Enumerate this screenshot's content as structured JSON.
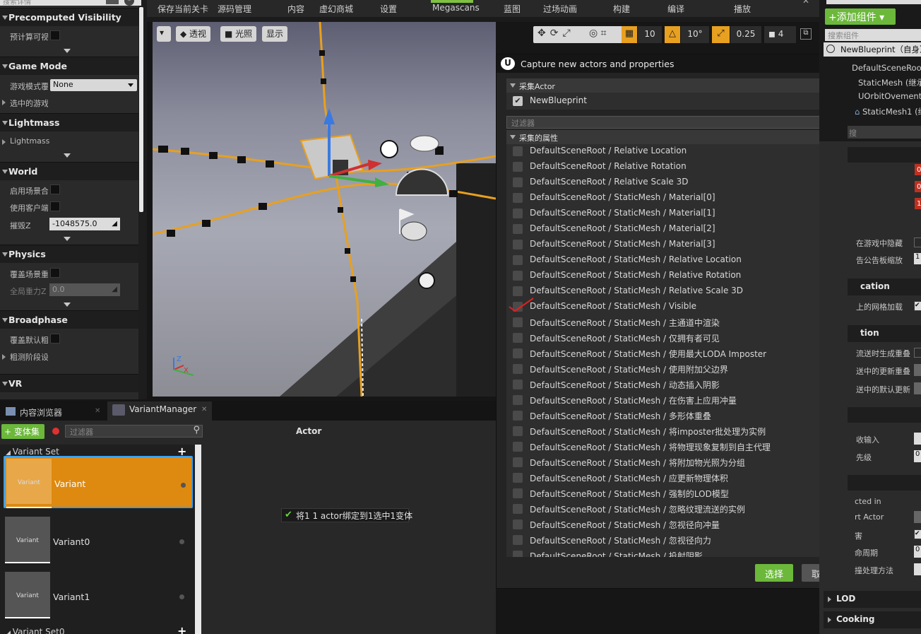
{
  "left_panel": {
    "sections": [
      {
        "title": "Precomputed Visibility"
      },
      {
        "title": "Game Mode"
      },
      {
        "title": "Lightmass"
      },
      {
        "title": "World"
      },
      {
        "title": "Physics"
      },
      {
        "title": "Broadphase"
      },
      {
        "title": "VR"
      }
    ],
    "props": {
      "precompute": "预计算可视",
      "game_mode": "游戏模式覆",
      "game_mode_value": "None",
      "selected_game": "选中的游戏",
      "lightmass": "Lightmass",
      "enable_world": "启用场景合",
      "use_client": "使用客户端",
      "kill_z": "摧毁Z",
      "kill_z_value": "-1048575.0",
      "override_physics": "覆盖场景重",
      "global_gravity": "全局重力Z",
      "global_gravity_value": "0.0",
      "override_broadphase": "覆盖默认粗",
      "broadphase_stage": "粗测阶段设"
    }
  },
  "toolbar": {
    "items": [
      "保存当前关卡",
      "源码管理",
      "内容",
      "虚幻商城",
      "设置",
      "Megascans",
      "蓝图",
      "过场动画",
      "构建",
      "编译",
      "播放"
    ],
    "search_placeholder": "搜索详情"
  },
  "viewport": {
    "perspective": "透视",
    "lit": "光照",
    "show": "显示",
    "grid_snap": "10",
    "rot_snap": "10°",
    "scale_snap": "0.25",
    "cam_speed": "4"
  },
  "dialog": {
    "title": "Capture new actors and properties",
    "actor_section": "采集Actor",
    "actor_name": "NewBlueprint",
    "filter_placeholder": "过滤器",
    "props_section": "采集的属性",
    "properties": [
      "DefaultSceneRoot / Relative Location",
      "DefaultSceneRoot / Relative Rotation",
      "DefaultSceneRoot / Relative Scale 3D",
      "DefaultSceneRoot / StaticMesh / Material[0]",
      "DefaultSceneRoot / StaticMesh / Material[1]",
      "DefaultSceneRoot / StaticMesh / Material[2]",
      "DefaultSceneRoot / StaticMesh / Material[3]",
      "DefaultSceneRoot / StaticMesh / Relative Location",
      "DefaultSceneRoot / StaticMesh / Relative Rotation",
      "DefaultSceneRoot / StaticMesh / Relative Scale 3D",
      "DefaultSceneRoot / StaticMesh / Visible",
      "DefaultSceneRoot / StaticMesh / 主通道中渲染",
      "DefaultSceneRoot / StaticMesh / 仅拥有者可见",
      "DefaultSceneRoot / StaticMesh / 使用最大LODA Imposter",
      "DefaultSceneRoot / StaticMesh / 使用附加父边界",
      "DefaultSceneRoot / StaticMesh / 动态插入阴影",
      "DefaultSceneRoot / StaticMesh / 在伤害上应用冲量",
      "DefaultSceneRoot / StaticMesh / 多形体重叠",
      "DefaultSceneRoot / StaticMesh / 将imposter批处理为实例",
      "DefaultSceneRoot / StaticMesh / 将物理现象复制到自主代理",
      "DefaultSceneRoot / StaticMesh / 将附加物光照为分组",
      "DefaultSceneRoot / StaticMesh / 应更新物理体积",
      "DefaultSceneRoot / StaticMesh / 强制的LOD模型",
      "DefaultSceneRoot / StaticMesh / 忽略纹理流送的实例",
      "DefaultSceneRoot / StaticMesh / 忽视径向冲量",
      "DefaultSceneRoot / StaticMesh / 忽视径向力",
      "DefaultSceneRoot / StaticMesh / 投射阴影"
    ],
    "select_label": "选择",
    "cancel_label": "取消"
  },
  "right_panel": {
    "add_component": "+添加组件",
    "search_placeholder": "搜索组件",
    "tree": [
      "NewBlueprint（自身）",
      "DefaultSceneRoot",
      "StaticMesh (继承",
      "UOrbitOvement (",
      "StaticMesh1 (继"
    ],
    "details_search": "搜",
    "labels": [
      "在游戏中隐藏",
      "告公告板缩放",
      "cation",
      "上的网格加载",
      "tion",
      "流送时生成重叠",
      "送中的更新重叠",
      "送中的默认更新",
      "收输入",
      "先级",
      "cted in",
      "rt Actor",
      "害",
      "命周期",
      "撞处理方法"
    ],
    "values": [
      "0",
      "0",
      "1",
      "1",
      "0",
      "0"
    ],
    "sections": [
      "LOD",
      "Cooking"
    ]
  },
  "tabs": {
    "content_browser": "内容浏览器",
    "variant_manager": "VariantManager"
  },
  "variant_manager": {
    "variant_set_btn": "+ 变体集",
    "filter_placeholder": "过滤器",
    "actor_header": "Actor",
    "variant_set": "Variant Set",
    "variant_set2": "Variant Set0",
    "variants": [
      {
        "name": "Variant",
        "thumb": "Variant"
      },
      {
        "name": "Variant0",
        "thumb": "Variant"
      },
      {
        "name": "Variant1",
        "thumb": "Variant"
      }
    ],
    "binding_msg": "将1 1 actor绑定到1选中1变体"
  }
}
